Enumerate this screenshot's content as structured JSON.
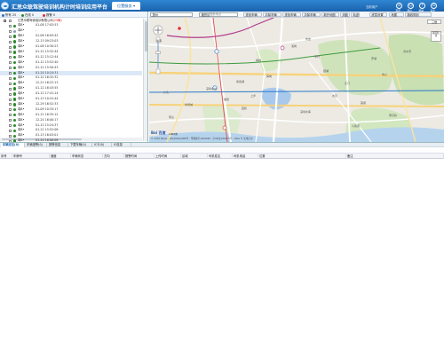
{
  "header": {
    "title": "汇思众联驾驶培训机构计时培训应用平台",
    "active_tab": "位置服务 ▾",
    "user": "当前用户",
    "icons": [
      {
        "name": "home-icon",
        "glyph": "⌂",
        "label": "首页"
      },
      {
        "name": "user-icon",
        "glyph": "☺",
        "label": "用户"
      },
      {
        "name": "help-icon",
        "glyph": "?",
        "label": "帮助"
      },
      {
        "name": "exit-icon",
        "glyph": "⏻",
        "label": "退出"
      }
    ]
  },
  "tree": {
    "toolbar": {
      "all_label": "所有 25",
      "online_label": "在线 0",
      "alarm_label": "报警 0"
    },
    "group": {
      "name": "汇思众联驾驶培训有限公司",
      "count": "(25辆)"
    },
    "vehicles": [
      {
        "plate": "粤B•",
        "time": "01-08 17:03:53",
        "online": true
      },
      {
        "plate": "粤B•",
        "time": "-",
        "online": false
      },
      {
        "plate": "粤B•",
        "time": "01-08 16:03:42",
        "online": true
      },
      {
        "plate": "粤B•",
        "time": "12-13 09:23:03",
        "online": true
      },
      {
        "plate": "粤B•",
        "time": "01-08 10:30:23",
        "online": true
      },
      {
        "plate": "粤B•",
        "time": "01-12 15:32:44",
        "online": true
      },
      {
        "plate": "粤B•",
        "time": "01-12 15:12:44",
        "online": true
      },
      {
        "plate": "粤B•",
        "time": "01-12 15:52:40",
        "online": true
      },
      {
        "plate": "粤B•",
        "time": "01-12 15:50:43",
        "online": true
      },
      {
        "plate": "粤B•",
        "time": "01-20 10:24:31",
        "online": true
      },
      {
        "plate": "粤B•",
        "time": "01-12 16:32:32",
        "online": true
      },
      {
        "plate": "粤B•",
        "time": "12-21 16:22:13",
        "online": true
      },
      {
        "plate": "粤B•",
        "time": "01-12 16:43:55",
        "online": true
      },
      {
        "plate": "粤B•",
        "time": "01-12 17:41:14",
        "online": true
      },
      {
        "plate": "粤B•",
        "time": "01-13 10:41:44",
        "online": true
      },
      {
        "plate": "粤B•",
        "time": "12-29 16:52:33",
        "online": true
      },
      {
        "plate": "粤B•",
        "time": "01-09 10:33:17",
        "online": true
      },
      {
        "plate": "粤B•",
        "time": "01-12 16:35:12",
        "online": true
      },
      {
        "plate": "粤B•",
        "time": "12-24 16:00:17",
        "online": true
      },
      {
        "plate": "粤B•",
        "time": "01-12 15:24:37",
        "online": true
      },
      {
        "plate": "粤B•",
        "time": "01-12 15:52:06",
        "online": true
      },
      {
        "plate": "粤B•",
        "time": "01-13 16:03:01",
        "online": true
      },
      {
        "plate": "粤B•",
        "time": "01-20 16:06:06",
        "online": true
      }
    ]
  },
  "map": {
    "toolbar": {
      "city": "惠州",
      "district": "福田区",
      "place": "搜索地点",
      "buttons": [
        "查找车辆",
        "清除车辆",
        "查找车辆",
        "清除车辆",
        "新开地图",
        "测距",
        "轨迹",
        "底层设置",
        "地图",
        "路线规划"
      ]
    },
    "map_type": "三维",
    "traffic": "路况信息",
    "labels": [
      "香港",
      "罗湖",
      "布吉",
      "福田",
      "南山",
      "深圳北站",
      "莲塘",
      "黄贝岭",
      "华侨城",
      "沙头",
      "香蜜湖",
      "上步",
      "泥岗",
      "翠竹",
      "东门",
      "清水河",
      "梅林",
      "笋岗",
      "园岭",
      "深圳水库",
      "银湖",
      "布心",
      "水贝",
      "人民南"
    ],
    "baidu": "Bai 百度",
    "scale": "1000米",
    "copyright": "© 2016 Baidu - GS(2016)2089号 - 甲测资字1100930 - 京ICP证030173号 - Data © 长地万方"
  },
  "bottom": {
    "tabs": [
      "车辆定位(0)",
      "车辆报警(0)",
      "报警信息",
      "下载车辆(0)",
      "IC卡(0)",
      "IC信息"
    ],
    "columns": [
      "序号",
      "车牌号",
      "速度",
      "车辆状态",
      "方向",
      "报警时间",
      "上传时间",
      "区域",
      "司机姓名",
      "司机电话",
      "位置",
      "备注"
    ]
  }
}
